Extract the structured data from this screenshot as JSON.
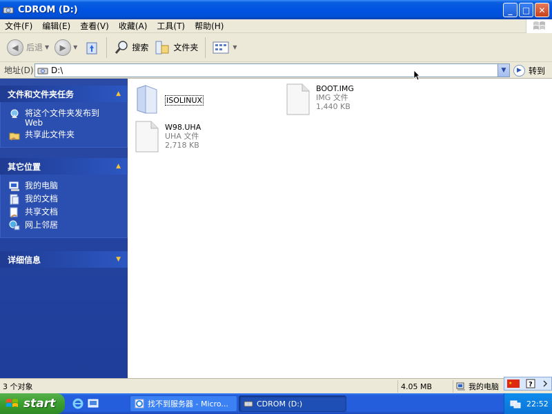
{
  "window": {
    "title": "CDROM (D:)",
    "buttons": {
      "minimize": "_",
      "maximize": "□",
      "close": "✕"
    }
  },
  "menubar": {
    "items": [
      "文件(F)",
      "编辑(E)",
      "查看(V)",
      "收藏(A)",
      "工具(T)",
      "帮助(H)"
    ]
  },
  "toolbar": {
    "back_label": "后退",
    "search_label": "搜索",
    "folders_label": "文件夹"
  },
  "address": {
    "label": "地址(D)",
    "value": "D:\\",
    "go_label": "转到"
  },
  "sidebar": {
    "tasks": {
      "title": "文件和文件夹任务",
      "items": [
        {
          "label": "将这个文件夹发布到 Web",
          "icon": "publish-web-icon"
        },
        {
          "label": "共享此文件夹",
          "icon": "share-folder-icon"
        }
      ]
    },
    "places": {
      "title": "其它位置",
      "items": [
        {
          "label": "我的电脑",
          "icon": "my-computer-icon"
        },
        {
          "label": "我的文档",
          "icon": "my-documents-icon"
        },
        {
          "label": "共享文档",
          "icon": "shared-documents-icon"
        },
        {
          "label": "网上邻居",
          "icon": "network-places-icon"
        }
      ]
    },
    "details": {
      "title": "详细信息"
    }
  },
  "files": [
    {
      "name": "ISOLINUX",
      "type": "",
      "size": "",
      "kind": "folder"
    },
    {
      "name": "BOOT.IMG",
      "type": "IMG 文件",
      "size": "1,440 KB",
      "kind": "file"
    },
    {
      "name": "W98.UHA",
      "type": "UHA 文件",
      "size": "2,718 KB",
      "kind": "file"
    }
  ],
  "statusbar": {
    "count": "3 个对象",
    "size": "4.05 MB",
    "location": "我的电脑"
  },
  "taskbar": {
    "start_label": "start",
    "tasks": [
      {
        "label": "找不到服务器 - Micro...",
        "active": false
      },
      {
        "label": "CDROM (D:)",
        "active": true
      }
    ],
    "clock": "22:52"
  },
  "colors": {
    "titlebar": "#0053e1",
    "sidebar": "#2b4fb0",
    "taskbar": "#245edc",
    "start": "#3a9e2f"
  }
}
